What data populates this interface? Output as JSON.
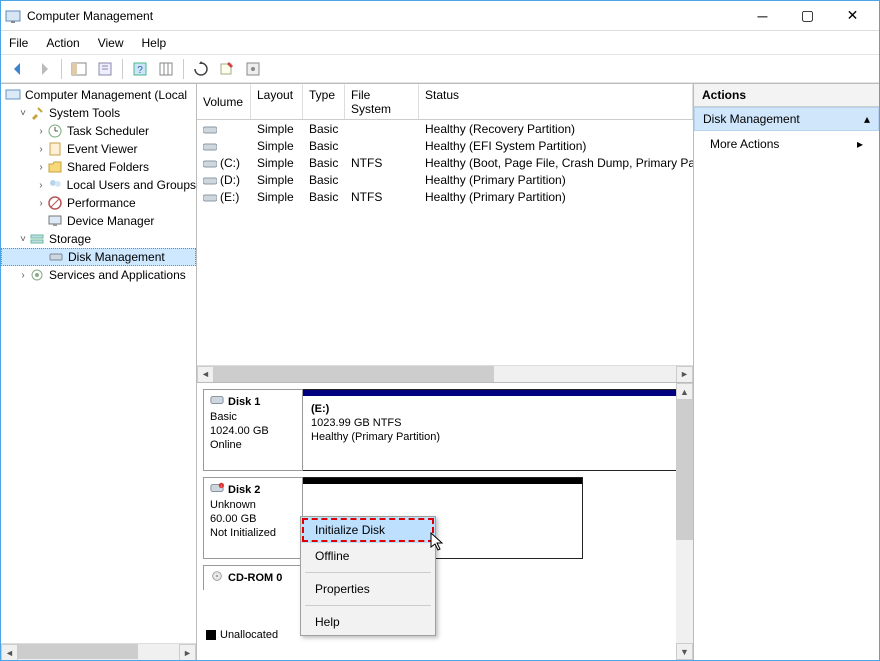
{
  "window": {
    "title": "Computer Management"
  },
  "menu": {
    "file": "File",
    "action": "Action",
    "view": "View",
    "help": "Help"
  },
  "tree": {
    "root": "Computer Management (Local",
    "system_tools": "System Tools",
    "task_scheduler": "Task Scheduler",
    "event_viewer": "Event Viewer",
    "shared_folders": "Shared Folders",
    "local_users": "Local Users and Groups",
    "performance": "Performance",
    "device_manager": "Device Manager",
    "storage": "Storage",
    "disk_management": "Disk Management",
    "services_apps": "Services and Applications"
  },
  "cols": {
    "volume": "Volume",
    "layout": "Layout",
    "type": "Type",
    "fs": "File System",
    "status": "Status"
  },
  "volumes": [
    {
      "label": "",
      "layout": "Simple",
      "type": "Basic",
      "fs": "",
      "status": "Healthy (Recovery Partition)"
    },
    {
      "label": "",
      "layout": "Simple",
      "type": "Basic",
      "fs": "",
      "status": "Healthy (EFI System Partition)"
    },
    {
      "label": "(C:)",
      "layout": "Simple",
      "type": "Basic",
      "fs": "NTFS",
      "status": "Healthy (Boot, Page File, Crash Dump, Primary Parti"
    },
    {
      "label": "(D:)",
      "layout": "Simple",
      "type": "Basic",
      "fs": "",
      "status": "Healthy (Primary Partition)"
    },
    {
      "label": "(E:)",
      "layout": "Simple",
      "type": "Basic",
      "fs": "NTFS",
      "status": "Healthy (Primary Partition)"
    }
  ],
  "disks": {
    "disk1": {
      "name": "Disk 1",
      "type": "Basic",
      "size": "1024.00 GB",
      "state": "Online",
      "vol": {
        "letter": "(E:)",
        "size_fs": "1023.99 GB NTFS",
        "status": "Healthy (Primary Partition)"
      }
    },
    "disk2": {
      "name": "Disk 2",
      "type": "Unknown",
      "size": "60.00 GB",
      "state": "Not Initialized"
    },
    "cdrom": {
      "name": "CD-ROM 0"
    }
  },
  "legend": {
    "unallocated": "Unallocated"
  },
  "actions": {
    "header": "Actions",
    "dm": "Disk Management",
    "more": "More Actions"
  },
  "context": {
    "init": "Initialize Disk",
    "offline": "Offline",
    "props": "Properties",
    "help": "Help"
  }
}
